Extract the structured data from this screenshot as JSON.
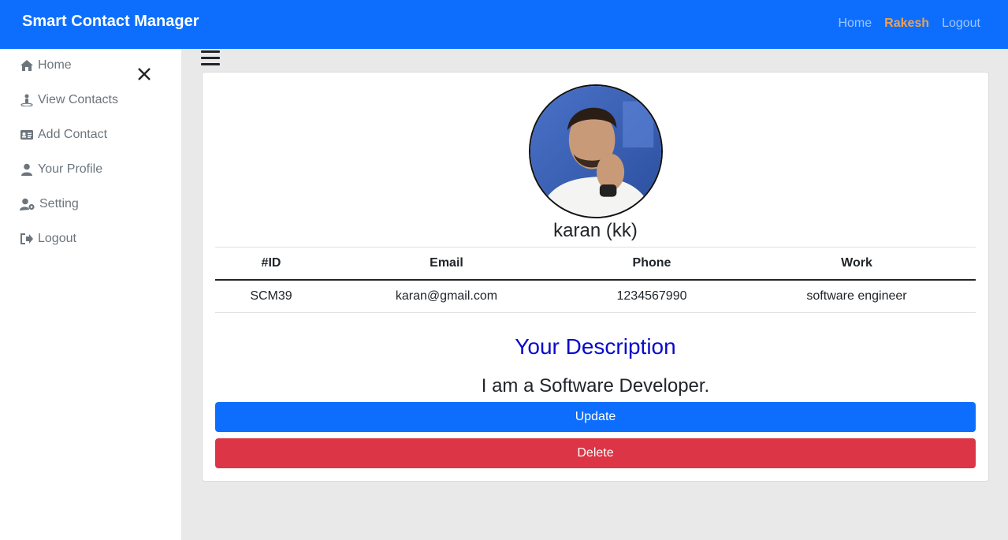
{
  "navbar": {
    "brand": "Smart Contact Manager",
    "links": {
      "home": "Home",
      "user": "Rakesh",
      "logout": "Logout"
    }
  },
  "sidebar": {
    "items": [
      {
        "label": "Home",
        "icon": "home-icon"
      },
      {
        "label": "View Contacts",
        "icon": "contacts-icon"
      },
      {
        "label": "Add Contact",
        "icon": "id-card-icon"
      },
      {
        "label": "Your Profile",
        "icon": "user-icon"
      },
      {
        "label": "Setting",
        "icon": "user-cog-icon"
      },
      {
        "label": "Logout",
        "icon": "sign-out-icon"
      }
    ]
  },
  "contact": {
    "name": "karan (kk)",
    "table": {
      "headers": [
        "#ID",
        "Email",
        "Phone",
        "Work"
      ],
      "row": [
        "SCM39",
        "karan@gmail.com",
        "1234567990",
        "software engineer"
      ]
    },
    "description_title": "Your Description",
    "description": "I am a Software Developer."
  },
  "actions": {
    "update": "Update",
    "delete": "Delete"
  },
  "colors": {
    "primary": "#0d6efd",
    "danger": "#dc3545",
    "accent_user": "#f0a050",
    "description_title": "#0a0acd"
  }
}
